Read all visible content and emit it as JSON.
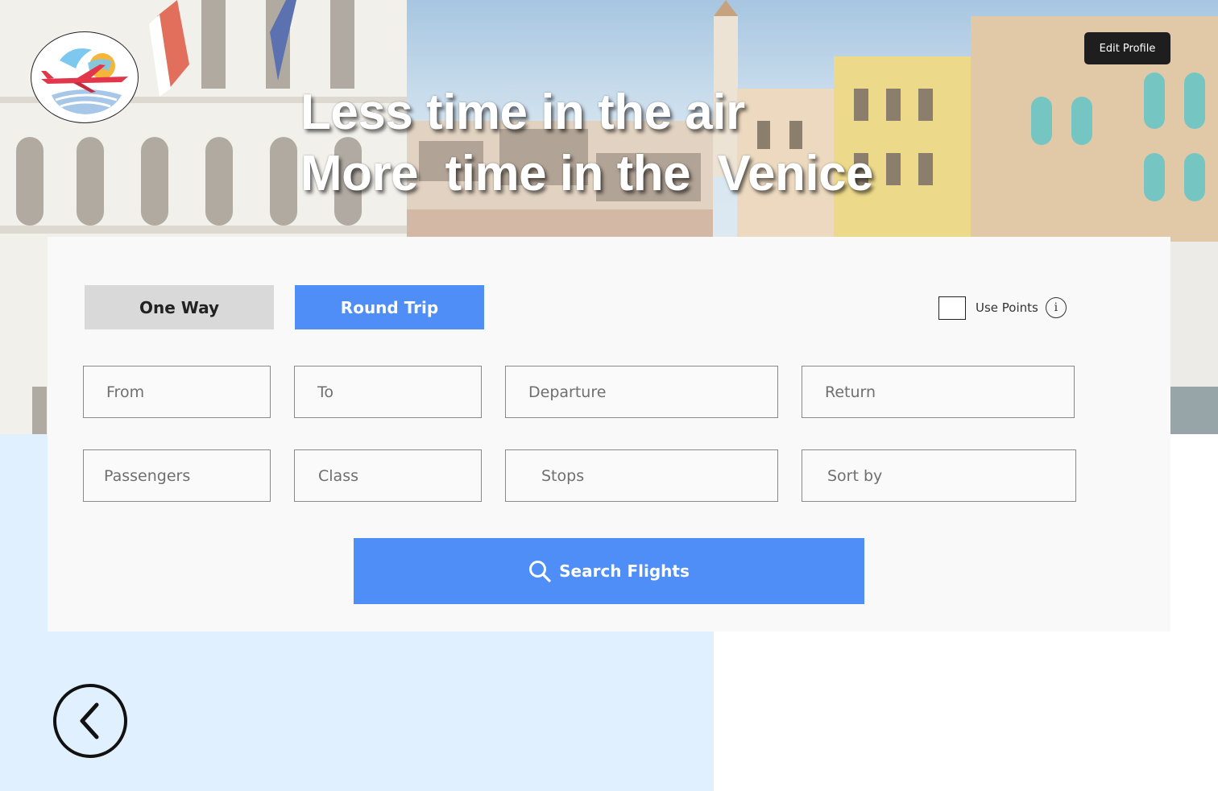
{
  "hero": {
    "headline_line1": "Less time in the air",
    "headline_line2": "More  time in the  Venice"
  },
  "header": {
    "logo_icon": "airplane-sun-logo-icon",
    "edit_profile_label": "Edit Profile"
  },
  "search": {
    "trip_types": [
      "One Way",
      "Round Trip"
    ],
    "selected_trip_type": "Round Trip",
    "use_points_label": "Use Points",
    "use_points_checked": false,
    "info_icon": "info-icon",
    "info_glyph": "i",
    "fields": {
      "from": "From",
      "to": "To",
      "departure": "Departure",
      "return": "Return",
      "passengers": "Passengers",
      "class": "Class",
      "stops": "Stops",
      "sort_by": "Sort by"
    },
    "search_button_label": "Search Flights",
    "search_icon": "search-icon"
  },
  "navigation": {
    "back_icon": "chevron-left-circle-icon"
  },
  "colors": {
    "accent": "#4f8ef7",
    "selected_inactive": "#d9d9d9",
    "card_bg": "#f9f9f9",
    "light_panel": "#e1f0fe",
    "dark_button": "#1e1e1e"
  }
}
